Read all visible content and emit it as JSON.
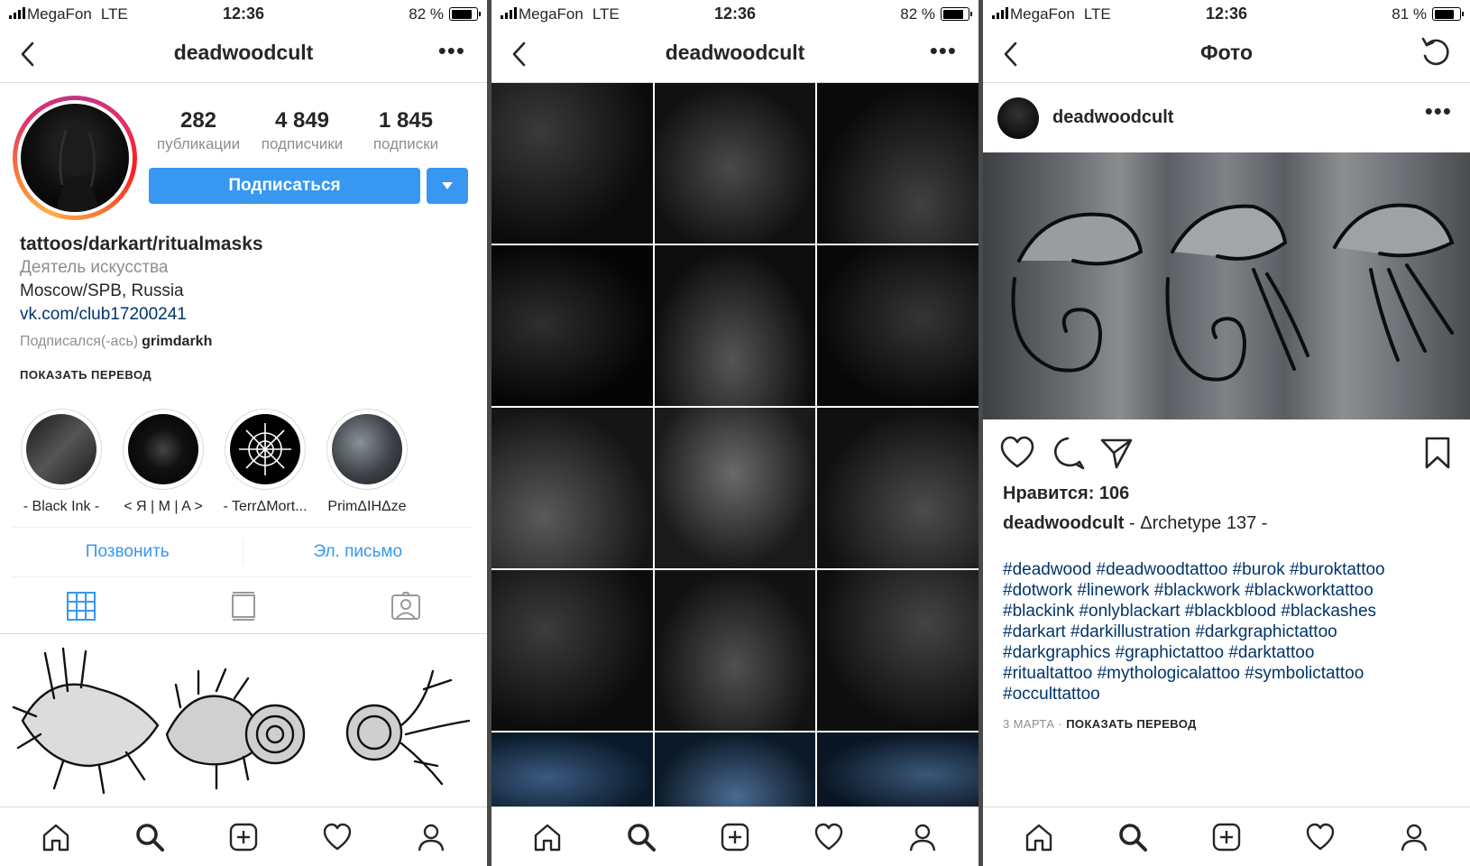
{
  "status_bars": [
    {
      "carrier": "MegaFon",
      "network": "LTE",
      "time": "12:36",
      "battery": "82 %",
      "battery_level": 0.82
    },
    {
      "carrier": "MegaFon",
      "network": "LTE",
      "time": "12:36",
      "battery": "82 %",
      "battery_level": 0.82
    },
    {
      "carrier": "MegaFon",
      "network": "LTE",
      "time": "12:36",
      "battery": "81 %",
      "battery_level": 0.81
    }
  ],
  "profile": {
    "username": "deadwoodcult",
    "stats": [
      {
        "value": "282",
        "label": "публикации"
      },
      {
        "value": "4 849",
        "label": "подписчики"
      },
      {
        "value": "1 845",
        "label": "подписки"
      }
    ],
    "follow_label": "Подписаться",
    "bio_title": "tattoos/darkart/ritualmasks",
    "category": "Деятель искусства",
    "location": "Moscow/SPB, Russia",
    "link": "vk.com/club17200241",
    "followed_by_prefix": "Подписался(-ась)",
    "followed_by_user": "grimdarkh",
    "show_translation": "ПОКАЗАТЬ ПЕРЕВОД",
    "highlights": [
      {
        "label": "- Black Ink -"
      },
      {
        "label": "< Я | M | A >"
      },
      {
        "label": "- TerrΔMort..."
      },
      {
        "label": "PrimΔIHΔze"
      }
    ],
    "contact_buttons": [
      "Позвонить",
      "Эл. письмо"
    ]
  },
  "grid_page": {
    "username": "deadwoodcult",
    "tiles": 15
  },
  "post": {
    "screen_title": "Фото",
    "username": "deadwoodcult",
    "likes": "Нравится: 106",
    "caption_user": "deadwoodcult",
    "caption_text": " - Δrchetype 137 -",
    "hashtags": [
      "#deadwood #deadwoodtattoo #burok #buroktattoo",
      "#dotwork #linework #blackwork #blackworktattoo",
      "#blackink #onlyblackart #blackblood #blackashes",
      "#darkart #darkillustration #darkgraphictattoo",
      "#darkgraphics #graphictattoo #darktattoo",
      "#ritualtattoo #mythologicalattoo #symbolictattoo",
      "#occulttattoo"
    ],
    "date": "3 МАРТА",
    "show_translation": "ПОКАЗАТЬ ПЕРЕВОД"
  },
  "icons": {
    "back": "chevron-left-icon",
    "more": "more-horizontal-icon",
    "refresh": "refresh-icon",
    "tab_home": "home-icon",
    "tab_search": "search-icon",
    "tab_new": "new-post-icon",
    "tab_activity": "heart-icon",
    "tab_profile": "profile-icon"
  },
  "colors": {
    "accent": "#3897f0",
    "link": "#003569",
    "muted": "#8e8e8e"
  }
}
